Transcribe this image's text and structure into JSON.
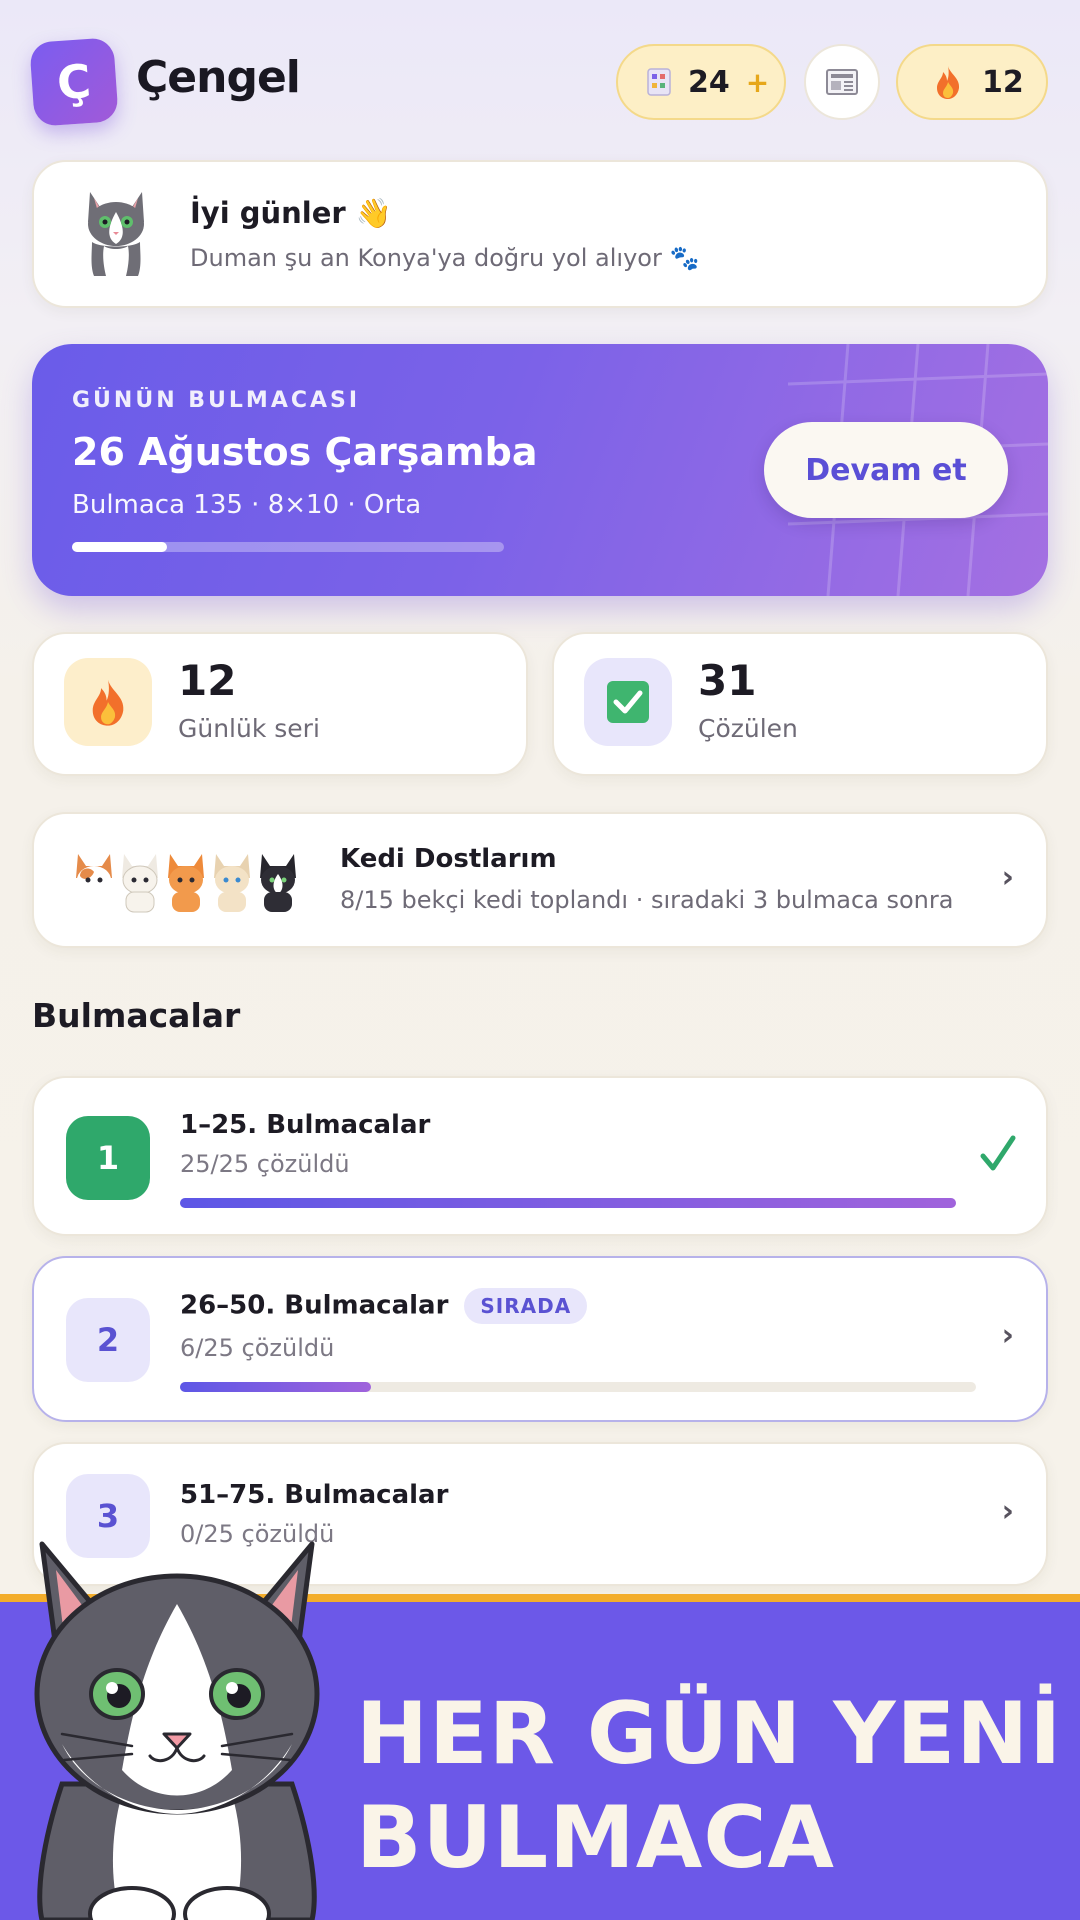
{
  "header": {
    "logo_letter": "Ç",
    "app_title": "Çengel",
    "coins": "24",
    "coins_plus": "+",
    "streak": "12"
  },
  "greeting": {
    "title": "İyi günler 👋",
    "subtitle": "Duman şu an Konya'ya doğru yol alıyor 🐾"
  },
  "daily": {
    "kicker": "GÜNÜN BULMACASI",
    "title": "26 Ağustos Çarşamba",
    "subtitle": "Bulmaca 135 · 8×10 · Orta",
    "progress": 0.22,
    "button": "Devam et"
  },
  "stats": [
    {
      "value": "12",
      "label": "Günlük seri"
    },
    {
      "value": "31",
      "label": "Çözülen"
    }
  ],
  "cats": {
    "title": "Kedi Dostlarım",
    "subtitle": "8/15 bekçi kedi toplandı · sıradaki 3 bulmaca sonra"
  },
  "section_title": "Bulmacalar",
  "packs": [
    {
      "number": "1",
      "title": "1–25. Bulmacalar",
      "subtitle": "25/25 çözüldü",
      "progress": 1.0,
      "status": "done"
    },
    {
      "number": "2",
      "title": "26–50. Bulmacalar",
      "badge": "SIRADA",
      "subtitle": "6/25 çözüldü",
      "progress": 0.24,
      "status": "next"
    },
    {
      "number": "3",
      "title": "51–75. Bulmacalar",
      "subtitle": "0/25 çözüldü",
      "progress": 0,
      "status": "locked"
    }
  ],
  "banner": {
    "line1": "HER GÜN YENİ",
    "line2": "BULMACA"
  },
  "colors": {
    "accent": "#6c58e8",
    "success": "#2fa86b",
    "banner_stripe": "#f3ad2b",
    "coin_pill": "#fdefc6"
  }
}
